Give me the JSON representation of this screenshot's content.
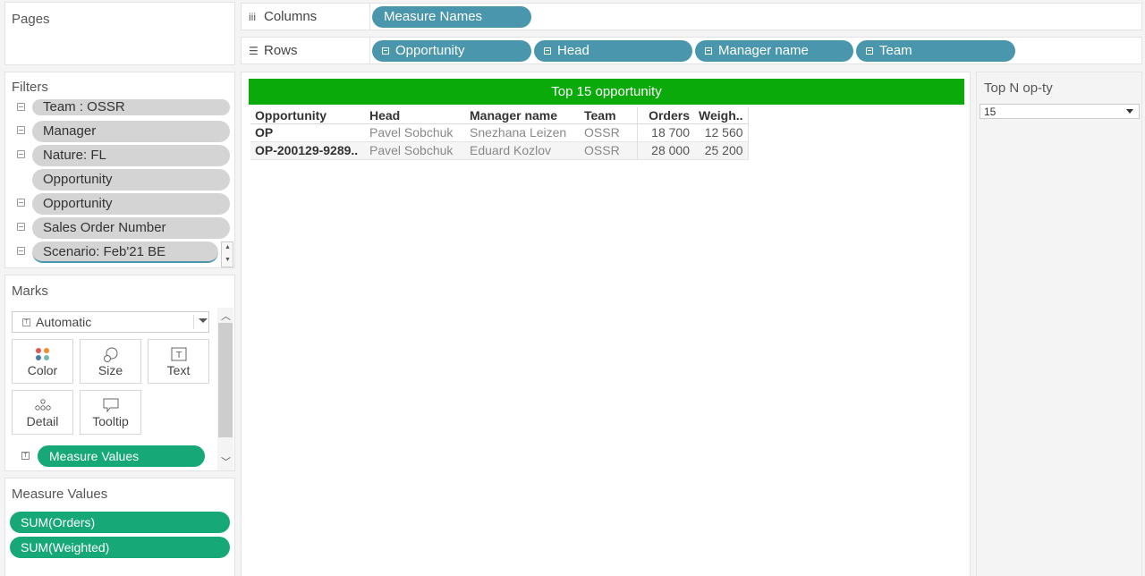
{
  "pages": {
    "title": "Pages"
  },
  "filters": {
    "title": "Filters",
    "items": [
      {
        "label": "Team  : OSSR",
        "has_icon": true
      },
      {
        "label": "Manager",
        "has_icon": true
      },
      {
        "label": "Nature: FL",
        "has_icon": true
      },
      {
        "label": "Opportunity",
        "has_icon": false
      },
      {
        "label": "Opportunity",
        "has_icon": true
      },
      {
        "label": "Sales Order Number",
        "has_icon": true
      },
      {
        "label": "Scenario: Feb'21 BE",
        "has_icon": true
      }
    ]
  },
  "marks": {
    "title": "Marks",
    "type_label": "Automatic",
    "cards": {
      "color": "Color",
      "size": "Size",
      "text": "Text",
      "detail": "Detail",
      "tooltip": "Tooltip"
    },
    "measure_values_pill": "Measure Values"
  },
  "measure_values": {
    "title": "Measure Values",
    "items": [
      "SUM(Orders)",
      "SUM(Weighted)"
    ]
  },
  "columns": {
    "label": "Columns",
    "pills": [
      "Measure Names"
    ]
  },
  "rows": {
    "label": "Rows",
    "pills": [
      "Opportunity",
      "Head",
      "Manager name",
      "Team"
    ]
  },
  "viz": {
    "title": "Top 15 opportunity",
    "headers": [
      "Opportunity",
      "Head",
      "Manager name",
      "Team",
      "Orders",
      "Weigh.."
    ],
    "rows": [
      [
        "OP",
        "Pavel Sobchuk",
        "Snezhana Leizen",
        "OSSR",
        "18 700",
        "12 560"
      ],
      [
        "OP-200129-9289..",
        "Pavel Sobchuk",
        "Eduard Kozlov",
        "OSSR",
        "28 000",
        "25 200"
      ]
    ]
  },
  "topn": {
    "title": "Top N op-ty",
    "selected": "15"
  },
  "colors": {
    "dimension_pill": "#4a96ad",
    "measure_pill": "#16a877",
    "title_bar": "#0aaa0a",
    "filter_pill": "#d4d4d4"
  }
}
